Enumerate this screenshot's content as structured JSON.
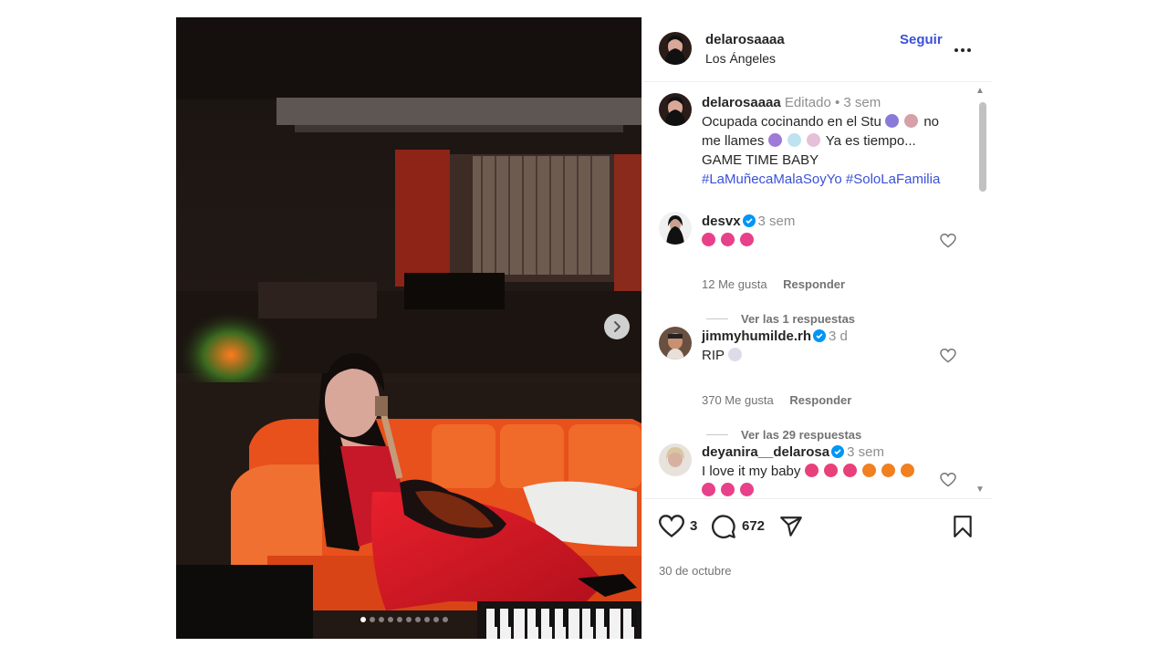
{
  "header": {
    "username": "delarosaaaa",
    "location": "Los Ángeles",
    "follow_label": "Seguir",
    "more_label": "..."
  },
  "caption": {
    "username": "delarosaaaa",
    "edited": "Editado",
    "separator": "•",
    "time": "3 sem",
    "line1": "Ocupada cocinando en el Stu",
    "line1_tail": "no",
    "line2_head": "me llames",
    "line2_tail": "Ya es tiempo...",
    "line3": "GAME TIME BABY",
    "hashtag1": "#LaMuñecaMalaSoyYo",
    "hashtag2": "#SoloLaFamilia"
  },
  "comments": [
    {
      "username": "desvx",
      "time": "3 sem",
      "text": "",
      "likes": "12 Me gusta",
      "reply": "Responder",
      "view_replies": "Ver las 1 respuestas"
    },
    {
      "username": "jimmyhumilde.rh",
      "time": "3 d",
      "text": "RIP",
      "likes": "370 Me gusta",
      "reply": "Responder",
      "view_replies": "Ver las 29 respuestas"
    },
    {
      "username": "deyanira__delarosa",
      "time": "3 sem",
      "text": "I love it my baby"
    }
  ],
  "actions": {
    "likes_count": "3",
    "comments_count": "672",
    "date": "30 de octubre"
  },
  "carousel": {
    "slide_count": 10,
    "active_index": 0
  },
  "colors": {
    "link": "#3b51d8",
    "verified": "#0095f6",
    "muted": "#737373"
  },
  "icons": [
    "more-icon",
    "heart-icon",
    "comment-icon",
    "share-icon",
    "save-icon",
    "chevron-right-icon",
    "verified-badge-icon"
  ]
}
